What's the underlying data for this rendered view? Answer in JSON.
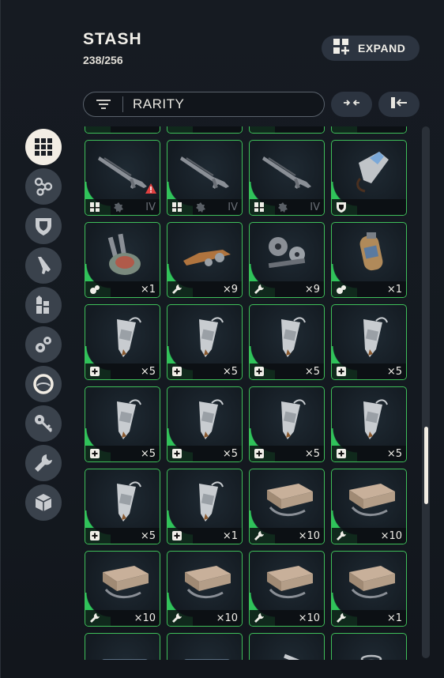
{
  "header": {
    "title": "STASH",
    "capacity": "238/256"
  },
  "toolbar": {
    "expand_label": "EXPAND",
    "sort_value": "RARITY"
  },
  "categories": [
    {
      "icon": "grid-icon",
      "active": true
    },
    {
      "icon": "attachments-icon"
    },
    {
      "icon": "shield-icon"
    },
    {
      "icon": "weapon-icon"
    },
    {
      "icon": "ammo-icon"
    },
    {
      "icon": "quick-use-icon"
    },
    {
      "icon": "augment-icon"
    },
    {
      "icon": "key-icon"
    },
    {
      "icon": "wrench-icon"
    },
    {
      "icon": "box-icon"
    }
  ],
  "rows": [
    [
      {
        "type": "rifle",
        "tag": "ammo-light",
        "mod": "IV",
        "warning": true,
        "qty": ""
      },
      {
        "type": "rifle",
        "tag": "ammo-light",
        "mod": "IV",
        "qty": ""
      },
      {
        "type": "rifle",
        "tag": "ammo-light",
        "mod": "IV",
        "qty": ""
      },
      {
        "type": "shield-item",
        "tag": "shield",
        "qty": ""
      }
    ],
    [
      {
        "type": "device",
        "tag": "quick-use",
        "qty": "×1"
      },
      {
        "type": "parts",
        "tag": "wrench",
        "qty": "×9"
      },
      {
        "type": "gears",
        "tag": "wrench",
        "qty": "×9"
      },
      {
        "type": "canister",
        "tag": "quick-use",
        "qty": "×1"
      }
    ],
    [
      {
        "type": "syringe",
        "tag": "plus",
        "qty": "×5"
      },
      {
        "type": "syringe",
        "tag": "plus",
        "qty": "×5"
      },
      {
        "type": "syringe",
        "tag": "plus",
        "qty": "×5"
      },
      {
        "type": "syringe",
        "tag": "plus",
        "qty": "×5"
      }
    ],
    [
      {
        "type": "syringe",
        "tag": "plus",
        "qty": "×5"
      },
      {
        "type": "syringe",
        "tag": "plus",
        "qty": "×5"
      },
      {
        "type": "syringe",
        "tag": "plus",
        "qty": "×5"
      },
      {
        "type": "syringe",
        "tag": "plus",
        "qty": "×5"
      }
    ],
    [
      {
        "type": "syringe",
        "tag": "plus",
        "qty": "×5"
      },
      {
        "type": "syringe",
        "tag": "plus",
        "qty": "×1"
      },
      {
        "type": "crate",
        "tag": "wrench",
        "qty": "×10"
      },
      {
        "type": "crate",
        "tag": "wrench",
        "qty": "×10"
      }
    ],
    [
      {
        "type": "crate",
        "tag": "wrench",
        "qty": "×10"
      },
      {
        "type": "crate",
        "tag": "wrench",
        "qty": "×10"
      },
      {
        "type": "crate",
        "tag": "wrench",
        "qty": "×10"
      },
      {
        "type": "crate",
        "tag": "wrench",
        "qty": "×1"
      }
    ],
    [
      {
        "type": "scope",
        "tag": "",
        "qty": ""
      },
      {
        "type": "scope",
        "tag": "",
        "qty": ""
      },
      {
        "type": "tube",
        "tag": "",
        "qty": ""
      },
      {
        "type": "spring",
        "tag": "",
        "qty": ""
      }
    ]
  ],
  "colors": {
    "rarity_green": "#3fbf5a",
    "accent_cream": "#f2ede4",
    "warning": "#e04040"
  }
}
